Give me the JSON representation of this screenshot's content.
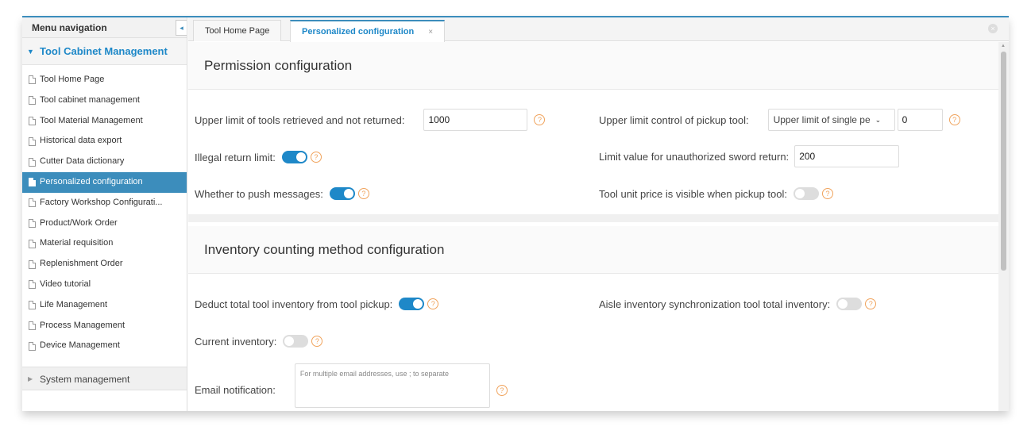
{
  "sidebar": {
    "title": "Menu navigation",
    "group": "Tool Cabinet Management",
    "items": [
      {
        "label": "Tool Home Page"
      },
      {
        "label": "Tool cabinet management"
      },
      {
        "label": "Tool Material Management"
      },
      {
        "label": "Historical data export"
      },
      {
        "label": "Cutter Data dictionary"
      },
      {
        "label": "Personalized configuration"
      },
      {
        "label": "Factory Workshop Configurati..."
      },
      {
        "label": "Product/Work Order"
      },
      {
        "label": "Material requisition"
      },
      {
        "label": "Replenishment Order"
      },
      {
        "label": "Video tutorial"
      },
      {
        "label": "Life Management"
      },
      {
        "label": "Process Management"
      },
      {
        "label": "Device Management"
      }
    ],
    "system": "System management"
  },
  "tabs": [
    {
      "label": "Tool Home Page"
    },
    {
      "label": "Personalized configuration",
      "close": "×"
    }
  ],
  "permission": {
    "title": "Permission configuration",
    "retrieved_label": "Upper limit of tools retrieved and not returned:",
    "retrieved_value": "1000",
    "pickup_label": "Upper limit control of pickup tool:",
    "pickup_select": "Upper limit of single pe",
    "pickup_value": "0",
    "illegal_label": "Illegal return limit:",
    "illegal_on": true,
    "unauth_label": "Limit value for unauthorized sword return:",
    "unauth_value": "200",
    "push_label": "Whether to push messages:",
    "push_on": true,
    "price_label": "Tool unit price is visible when pickup tool:",
    "price_on": false
  },
  "inventory": {
    "title": "Inventory counting method configuration",
    "deduct_label": "Deduct total tool inventory from tool pickup:",
    "deduct_on": true,
    "aisle_label": "Aisle inventory synchronization tool total inventory:",
    "aisle_on": false,
    "current_label": "Current inventory:",
    "current_on": false,
    "email_label": "Email notification:",
    "email_placeholder": "For multiple email addresses, use ; to separate"
  },
  "help_glyph": "?",
  "colors": {
    "accent": "#3c8dbc",
    "link": "#1e88c8",
    "help": "#f0a35c"
  }
}
